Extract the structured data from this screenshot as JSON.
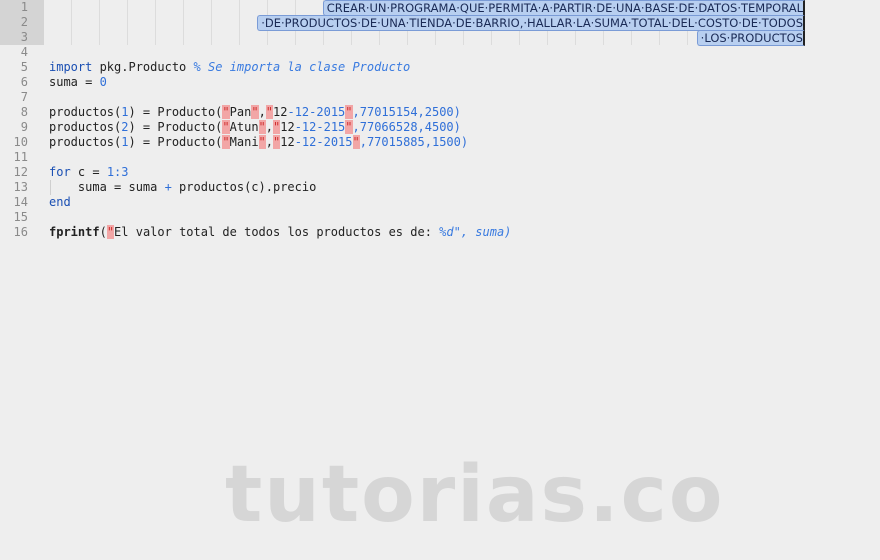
{
  "gutter": {
    "line_numbers": [
      "1",
      "2",
      "3",
      "4",
      "5",
      "6",
      "7",
      "8",
      "9",
      "10",
      "11",
      "12",
      "13",
      "14",
      "15",
      "16"
    ]
  },
  "banner": [
    "CREAR·UN·PROGRAMA·QUE·PERMITA·A·PARTIR·DE·UNA·BASE·DE·DATOS·TEMPORAL",
    "·DE·PRODUCTOS·DE·UNA·TIENDA·DE·BARRIO,·HALLAR·LA·SUMA·TOTAL·DEL·COSTO·DE·TODOS",
    "·LOS·PRODUCTOS"
  ],
  "code": {
    "l5": {
      "kw": "import",
      "text": " pkg.Producto ",
      "comment": "% Se importa la clase Producto"
    },
    "l6": {
      "text": "suma = ",
      "num": "0"
    },
    "l8": {
      "pre": "productos(",
      "idx": "1",
      "mid": ") = Producto(",
      "s1": "Pan",
      "s2a": "12",
      "s2b": "-12-2015",
      "rest": ",77015154,2500)"
    },
    "l9": {
      "pre": "productos(",
      "idx": "2",
      "mid": ") = Producto(",
      "s1": "Atun",
      "s2a": "12",
      "s2b": "-12-215",
      "rest": ",77066528,4500)"
    },
    "l10": {
      "pre": "productos(",
      "idx": "1",
      "mid": ") = Producto(",
      "s1": "Mani",
      "s2a": "12",
      "s2b": "-12-2015",
      "rest": ",77015885,1500)"
    },
    "l12": {
      "kw": "for",
      "text": " c = ",
      "num": "1:3"
    },
    "l13": {
      "text1": "    suma = suma ",
      "op": "+",
      "text2": " productos(c).precio"
    },
    "l14": {
      "kw": "end"
    },
    "l16": {
      "fn": "fprintf",
      "open": "(",
      "str": "El valor total de todos los productos es de: ",
      "tail": "%d\", suma)"
    }
  },
  "watermark": "tutorias.co"
}
